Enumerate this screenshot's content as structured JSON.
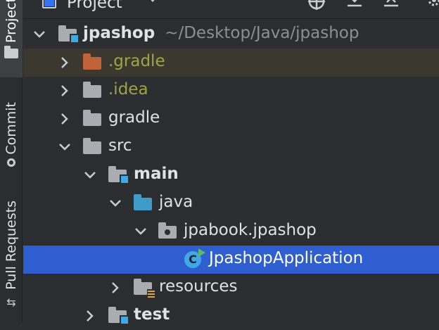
{
  "left_strip": {
    "tabs": [
      {
        "label": "Project"
      },
      {
        "label": "Commit"
      },
      {
        "label": "Pull Requests"
      }
    ]
  },
  "header": {
    "title": "Project",
    "icons": [
      "project-view-icon",
      "dropdown-icon",
      "locate-icon",
      "expand-all-icon",
      "collapse-all-icon",
      "settings-icon"
    ]
  },
  "tree": {
    "root": {
      "name": "jpashop",
      "path": "~/Desktop/Java/jpashop"
    },
    "items": [
      {
        "name": ".gradle"
      },
      {
        "name": ".idea"
      },
      {
        "name": "gradle"
      },
      {
        "name": "src"
      },
      {
        "name": "main"
      },
      {
        "name": "java"
      },
      {
        "name": "jpabook.jpashop"
      },
      {
        "name": "JpashopApplication"
      },
      {
        "name": "resources"
      },
      {
        "name": "test"
      }
    ]
  },
  "colors": {
    "background": "#2b2d30",
    "selection": "#2e5ed0",
    "excluded_highlight": "#3b392f",
    "excluded_text": "#a3a345",
    "source_folder": "#3f9cc9",
    "excluded_folder": "#c0633a"
  }
}
